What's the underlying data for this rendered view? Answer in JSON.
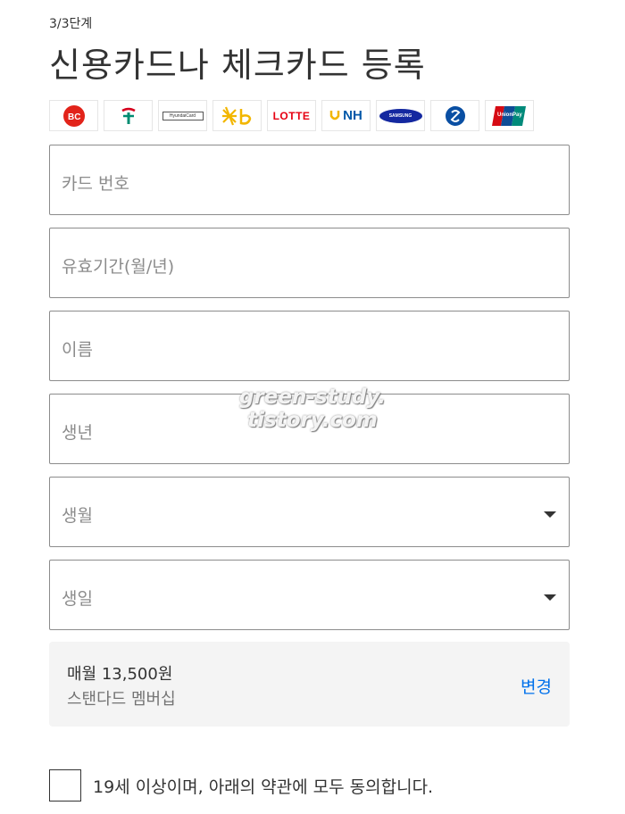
{
  "step": "3/3단계",
  "title": "신용카드나 체크카드 등록",
  "card_logos": [
    {
      "name": "bc-card-logo",
      "text": "BC"
    },
    {
      "name": "hana-card-logo",
      "text": ""
    },
    {
      "name": "hyundai-card-logo",
      "text": "HyundaiCard"
    },
    {
      "name": "kb-card-logo",
      "text": "KB"
    },
    {
      "name": "lotte-card-logo",
      "text": "LOTTE"
    },
    {
      "name": "nh-card-logo",
      "text": "NH"
    },
    {
      "name": "samsung-card-logo",
      "text": "SAMSUNG"
    },
    {
      "name": "shinhan-card-logo",
      "text": ""
    },
    {
      "name": "unionpay-card-logo",
      "text": "UnionPay"
    }
  ],
  "fields": {
    "card_number": {
      "placeholder": "카드 번호"
    },
    "expiry": {
      "placeholder": "유효기간(월/년)"
    },
    "name": {
      "placeholder": "이름"
    },
    "birth_year": {
      "placeholder": "생년"
    },
    "birth_month": {
      "placeholder": "생월"
    },
    "birth_day": {
      "placeholder": "생일"
    }
  },
  "plan": {
    "price": "매월 13,500원",
    "name": "스탠다드 멤버십",
    "change_label": "변경"
  },
  "agree": {
    "label": "19세 이상이며, 아래의 약관에 모두 동의합니다."
  },
  "watermark": {
    "line1": "green-study.",
    "line2": "tistory.com"
  },
  "colors": {
    "link": "#0071eb",
    "field_border": "#8c8c8c",
    "placeholder": "#8c8c8c",
    "plan_bg": "#f4f4f4"
  }
}
